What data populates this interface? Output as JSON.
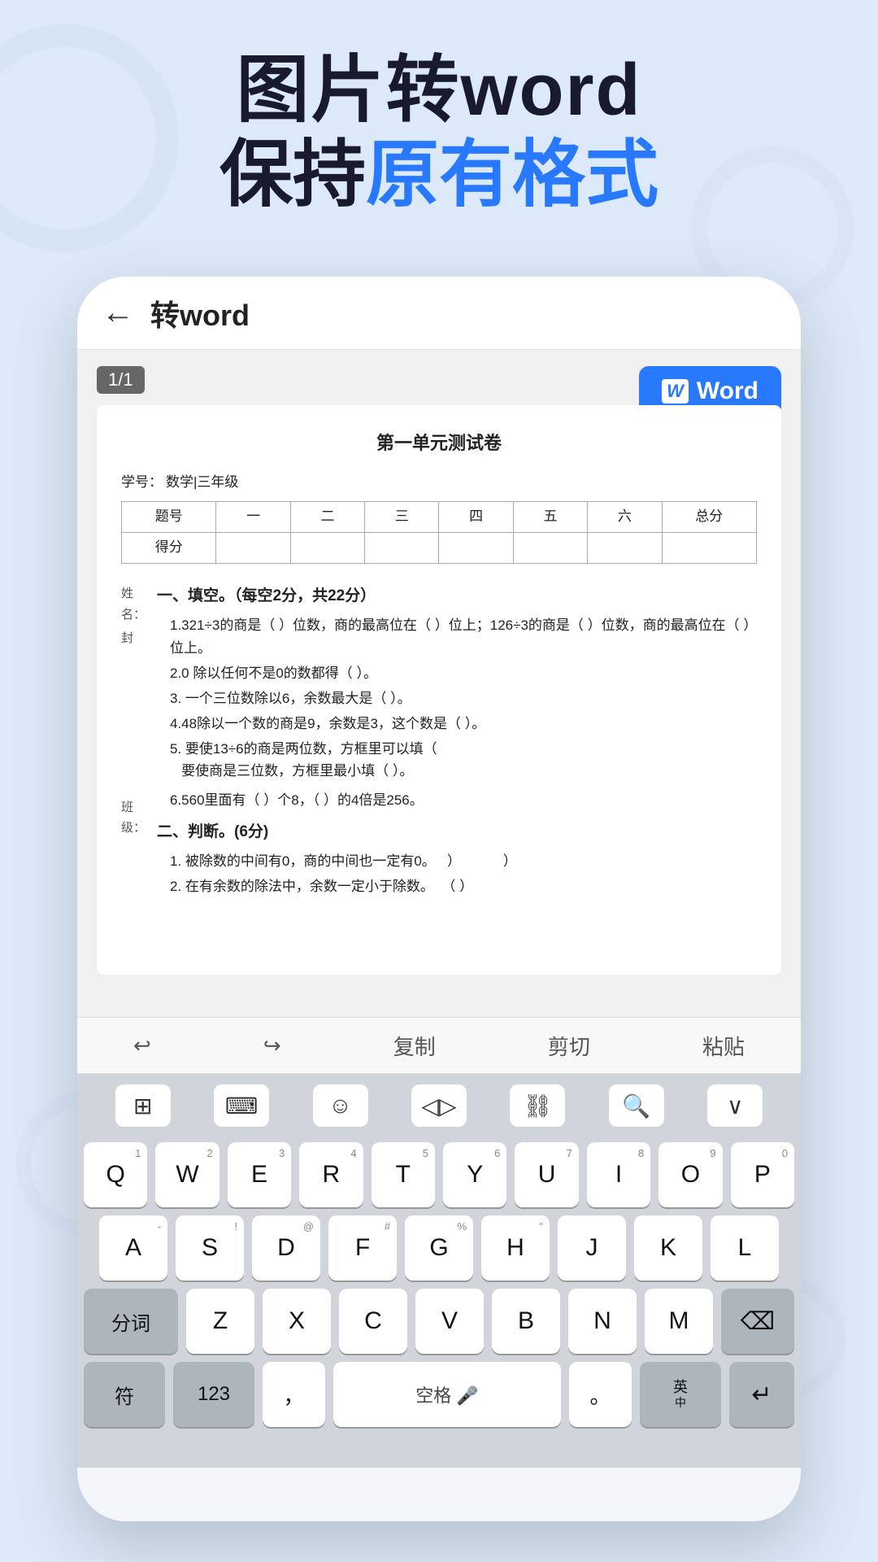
{
  "background_color": "#dce9f8",
  "header": {
    "line1": "图片转word",
    "line2_prefix": "保持",
    "line2_blue": "原有格式",
    "blue_color": "#2979ff"
  },
  "phone": {
    "app_header": {
      "back_label": "←",
      "title": "转word"
    },
    "page_badge": "1/1",
    "word_button": "Word",
    "document": {
      "title": "第一单元测试卷",
      "meta_label": "学号：",
      "meta_value": "数学|三年级",
      "table_headers": [
        "题号",
        "一",
        "二",
        "三",
        "四",
        "五",
        "六",
        "总分"
      ],
      "table_row2": [
        "得分",
        "",
        "",
        "",
        "",
        "",
        "",
        ""
      ],
      "side_labels": [
        "姓名：封",
        "班级："
      ],
      "sections": [
        {
          "title": "一、填空。（每空2分，共22分）",
          "items": [
            "1.321÷3的商是（ ）位数，商的最高位在（ ）位上；126÷3的商是（ ）位数，商的最高位在（ ）位上。",
            "2.0 除以任何不是0的数都得（ ）。",
            "3. 一个三位数除以6，余数最大是（ ）。",
            "4.48除以一个数的商是9，余数是3，这个数是（ ）。",
            "5. 要使13÷6的商是两位数，方框里可以填（要使商是三位数，方框里最小填（ ）。",
            "6.560里面有（   ）个8，（ ）的4倍是256。"
          ]
        },
        {
          "title": "二、判断。(6分)",
          "items": [
            "1. 被除数的中间有0，商的中间也一定有0。   ）           ）",
            "2. 在有余数的除法中，余数一定小于除数。  （ ）"
          ]
        }
      ]
    },
    "toolbar": {
      "undo": "↩",
      "redo": "↪",
      "copy": "复制",
      "cut": "剪切",
      "paste": "粘贴"
    },
    "keyboard": {
      "top_icons": [
        "grid",
        "keyboard",
        "emoji",
        "code",
        "link",
        "search",
        "chevron-down"
      ],
      "row1": [
        "Q",
        "W",
        "E",
        "R",
        "T",
        "Y",
        "U",
        "I",
        "O",
        "P"
      ],
      "row1_sub": [
        "1",
        "2",
        "3",
        "4",
        "5",
        "6",
        "7",
        "8",
        "9",
        "0"
      ],
      "row2": [
        "A",
        "S",
        "D",
        "F",
        "G",
        "H",
        "J",
        "K",
        "L"
      ],
      "row2_sub": [
        "-",
        "!",
        "@",
        "#",
        "%",
        "\"",
        "",
        "",
        ""
      ],
      "row3_left": "分词",
      "row3": [
        "Z",
        "X",
        "C",
        "V",
        "B",
        "N",
        "M"
      ],
      "row3_sub": [
        "",
        "",
        "",
        "",
        "",
        "",
        ""
      ],
      "row3_delete": "⌫",
      "row4_special": "符",
      "row4_num": "123",
      "row4_comma": "，",
      "row4_space": "空格",
      "row4_period": "。",
      "row4_lang": "英中",
      "row4_enter": "↵"
    }
  }
}
